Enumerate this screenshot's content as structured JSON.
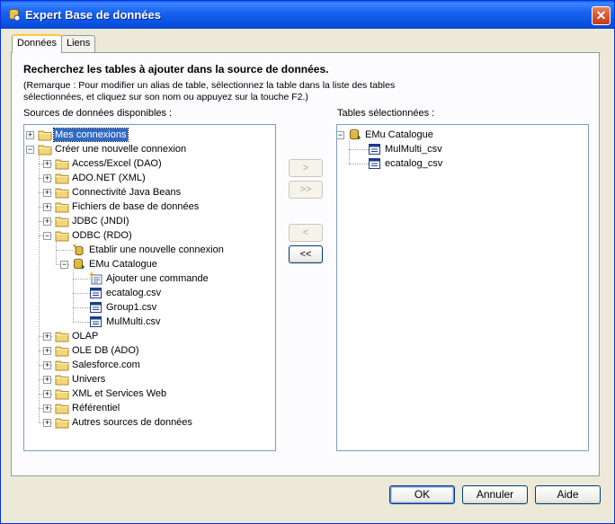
{
  "window": {
    "title": "Expert Base de données",
    "close_glyph": "✕"
  },
  "tabs": [
    {
      "label": "Données"
    },
    {
      "label": "Liens"
    }
  ],
  "heading": "Recherchez les tables à ajouter dans la source de données.",
  "note": "(Remarque : Pour modifier un alias de table, sélectionnez la table dans la liste des tables sélectionnées, et cliquez sur son nom ou appuyez sur la touche F2.)",
  "sources_label": "Sources de données disponibles :",
  "selected_label": "Tables sélectionnées :",
  "sources_tree": [
    {
      "label": "Mes connexions",
      "icon": "folder-icon",
      "expander": "+",
      "selected": true
    },
    {
      "label": "Créer une nouvelle connexion",
      "icon": "folder-icon",
      "expander": "−"
    },
    {
      "label": "Access/Excel (DAO)",
      "icon": "folder-icon",
      "expander": "+"
    },
    {
      "label": "ADO.NET (XML)",
      "icon": "folder-icon",
      "expander": "+"
    },
    {
      "label": "Connectivité Java Beans",
      "icon": "folder-icon",
      "expander": "+"
    },
    {
      "label": "Fichiers de base de données",
      "icon": "folder-icon",
      "expander": "+"
    },
    {
      "label": "JDBC (JNDI)",
      "icon": "folder-icon",
      "expander": "+"
    },
    {
      "label": "ODBC (RDO)",
      "icon": "folder-icon",
      "expander": "−"
    },
    {
      "label": "Etablir une nouvelle connexion",
      "icon": "new-connection-icon"
    },
    {
      "label": "EMu Catalogue",
      "icon": "database-icon",
      "expander": "−"
    },
    {
      "label": "Ajouter une commande",
      "icon": "add-command-icon"
    },
    {
      "label": "ecatalog.csv",
      "icon": "table-icon"
    },
    {
      "label": "Group1.csv",
      "icon": "table-icon"
    },
    {
      "label": "MulMulti.csv",
      "icon": "table-icon"
    },
    {
      "label": "OLAP",
      "icon": "folder-icon",
      "expander": "+"
    },
    {
      "label": "OLE DB (ADO)",
      "icon": "folder-icon",
      "expander": "+"
    },
    {
      "label": "Salesforce.com",
      "icon": "folder-icon",
      "expander": "+"
    },
    {
      "label": "Univers",
      "icon": "folder-icon",
      "expander": "+"
    },
    {
      "label": "XML et Services Web",
      "icon": "folder-icon",
      "expander": "+"
    },
    {
      "label": "Référentiel",
      "icon": "folder-icon",
      "expander": "+"
    },
    {
      "label": "Autres sources de données",
      "icon": "folder-icon",
      "expander": "+"
    }
  ],
  "selected_tree": [
    {
      "label": "EMu Catalogue",
      "icon": "database-icon",
      "expander": "−"
    },
    {
      "label": "MulMulti_csv",
      "icon": "table-icon"
    },
    {
      "label": "ecatalog_csv",
      "icon": "table-icon"
    }
  ],
  "move_buttons": [
    {
      "label": ">",
      "enabled": false
    },
    {
      "label": ">>",
      "enabled": false
    },
    {
      "label": "<",
      "enabled": false
    },
    {
      "label": "<<",
      "enabled": true
    }
  ],
  "dialog_buttons": {
    "ok": "OK",
    "cancel": "Annuler",
    "help": "Aide"
  },
  "colors": {
    "titlebar": "#0a5bf0",
    "selection": "#316ac5",
    "dialog_bg": "#ece9d8",
    "folder": "#f3d67a"
  }
}
